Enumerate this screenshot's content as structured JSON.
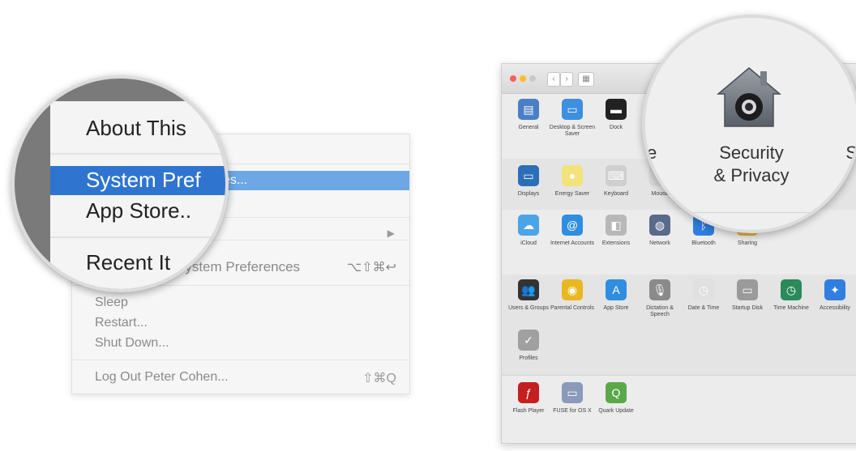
{
  "apple_menu": {
    "highlighted_text": "es...",
    "ghost_item": "System Preferences",
    "ghost_shortcut": "⌥⇧⌘↩",
    "submenu_arrow": "▶",
    "items_bottom": [
      {
        "label": "Sleep",
        "shortcut": ""
      },
      {
        "label": "Restart...",
        "shortcut": ""
      },
      {
        "label": "Shut Down...",
        "shortcut": ""
      }
    ],
    "logout": {
      "label": "Log Out Peter Cohen...",
      "shortcut": "⇧⌘Q"
    }
  },
  "magnifier_left": {
    "about": "About This",
    "system_prefs": "System Pref",
    "app_store": "App Store..",
    "recent": "Recent It"
  },
  "window": {
    "nav_back": "‹",
    "nav_fwd": "›",
    "nav_grid": "▦",
    "rows": [
      [
        {
          "label": "General",
          "icon": "general-icon",
          "color": "#4a7fc8",
          "glyph": "▤"
        },
        {
          "label": "Desktop & Screen Saver",
          "icon": "desktop-icon",
          "color": "#3d8fe0",
          "glyph": "▭"
        },
        {
          "label": "Dock",
          "icon": "dock-icon",
          "color": "#222222",
          "glyph": "▬"
        }
      ],
      [
        {
          "label": "Displays",
          "icon": "displays-icon",
          "color": "#2b6fb8",
          "glyph": "▭"
        },
        {
          "label": "Energy Saver",
          "icon": "energy-icon",
          "color": "#f2e37a",
          "glyph": "●"
        },
        {
          "label": "Keyboard",
          "icon": "keyboard-icon",
          "color": "#cfcfcf",
          "glyph": "⌨"
        },
        {
          "label": "Mouse",
          "icon": "mouse-icon",
          "color": "#d8d8d8",
          "glyph": "◖"
        }
      ],
      [
        {
          "label": "iCloud",
          "icon": "icloud-icon",
          "color": "#4aa4e8",
          "glyph": "☁"
        },
        {
          "label": "Internet Accounts",
          "icon": "at-icon",
          "color": "#2f8ee0",
          "glyph": "@"
        },
        {
          "label": "Extensions",
          "icon": "extensions-icon",
          "color": "#b8b8b8",
          "glyph": "◧"
        },
        {
          "label": "Network",
          "icon": "network-icon",
          "color": "#5a6a8a",
          "glyph": "◍"
        },
        {
          "label": "Bluetooth",
          "icon": "bluetooth-icon",
          "color": "#2f7ee0",
          "glyph": "ᛒ"
        },
        {
          "label": "Sharing",
          "icon": "sharing-icon",
          "color": "#e8b33a",
          "glyph": "◆"
        }
      ],
      [
        {
          "label": "Users & Groups",
          "icon": "users-icon",
          "color": "#333333",
          "glyph": "👥"
        },
        {
          "label": "Parental Controls",
          "icon": "parental-icon",
          "color": "#e8b820",
          "glyph": "◉"
        },
        {
          "label": "App Store",
          "icon": "appstore-icon",
          "color": "#2f8ee0",
          "glyph": "A"
        },
        {
          "label": "Dictation & Speech",
          "icon": "dictation-icon",
          "color": "#8a8a8a",
          "glyph": "🎙"
        },
        {
          "label": "Date & Time",
          "icon": "clock-icon",
          "color": "#e0e0e0",
          "glyph": "◷"
        },
        {
          "label": "Startup Disk",
          "icon": "disk-icon",
          "color": "#9a9a9a",
          "glyph": "▭"
        },
        {
          "label": "Time Machine",
          "icon": "timemachine-icon",
          "color": "#2a8a5a",
          "glyph": "◷"
        },
        {
          "label": "Accessibility",
          "icon": "accessibility-icon",
          "color": "#2f7ee0",
          "glyph": "✦"
        }
      ],
      [
        {
          "label": "Profiles",
          "icon": "profiles-icon",
          "color": "#a0a0a0",
          "glyph": "✓"
        }
      ],
      [
        {
          "label": "Flash Player",
          "icon": "flash-icon",
          "color": "#c42020",
          "glyph": "ƒ"
        },
        {
          "label": "FUSE for OS X",
          "icon": "fuse-icon",
          "color": "#8a9ab8",
          "glyph": "▭"
        },
        {
          "label": "Quark Update",
          "icon": "quark-icon",
          "color": "#5aa84a",
          "glyph": "Q"
        }
      ]
    ]
  },
  "magnifier_right": {
    "label_line1": "Security",
    "label_line2": "& Privacy",
    "edge_left": "e",
    "edge_right": "S"
  }
}
